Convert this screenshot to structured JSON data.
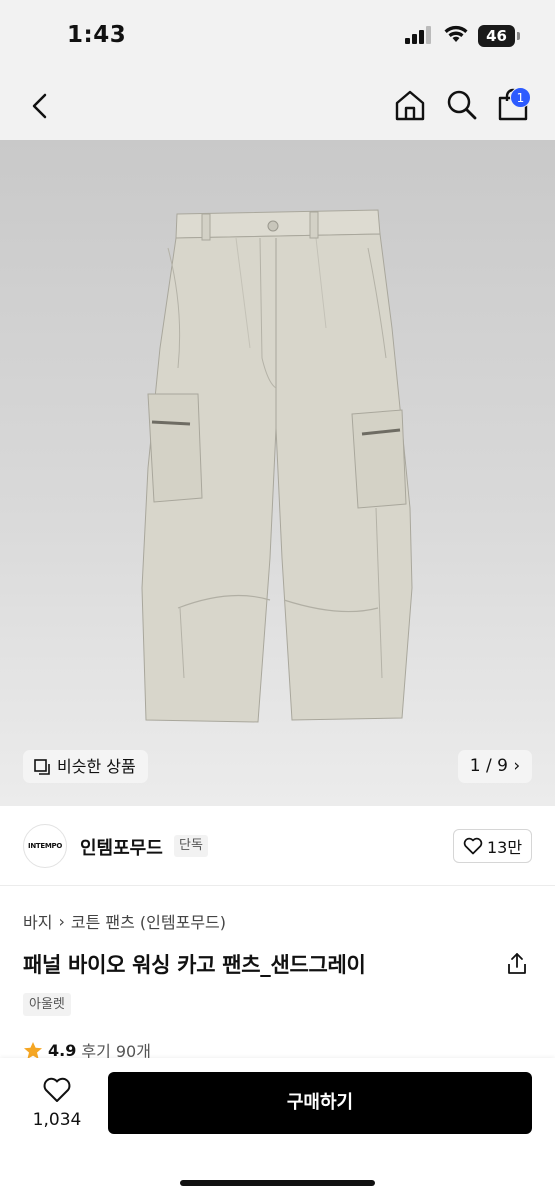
{
  "status_bar": {
    "time": "1:43",
    "battery": "46"
  },
  "nav": {
    "cart_count": "1"
  },
  "gallery": {
    "similar_label": "비슷한 상품",
    "pager": "1 / 9"
  },
  "brand": {
    "logo_text": "INTEMPO",
    "name": "인템포무드",
    "tag": "단독",
    "likes": "13만"
  },
  "product": {
    "breadcrumb": [
      "바지",
      "코튼 팬츠 (인템포무드)"
    ],
    "title": "패널 바이오 워싱 카고 팬츠_샌드그레이",
    "tag": "아울렛",
    "rating": "4.9",
    "reviews": "후기 90개"
  },
  "bottom": {
    "wish_count": "1,034",
    "buy_label": "구매하기"
  },
  "colors": {
    "accent": "#2d5bff",
    "primary_button": "#000000",
    "rating_star": "#f5a623",
    "product_fabric": "#d8d6cb"
  }
}
